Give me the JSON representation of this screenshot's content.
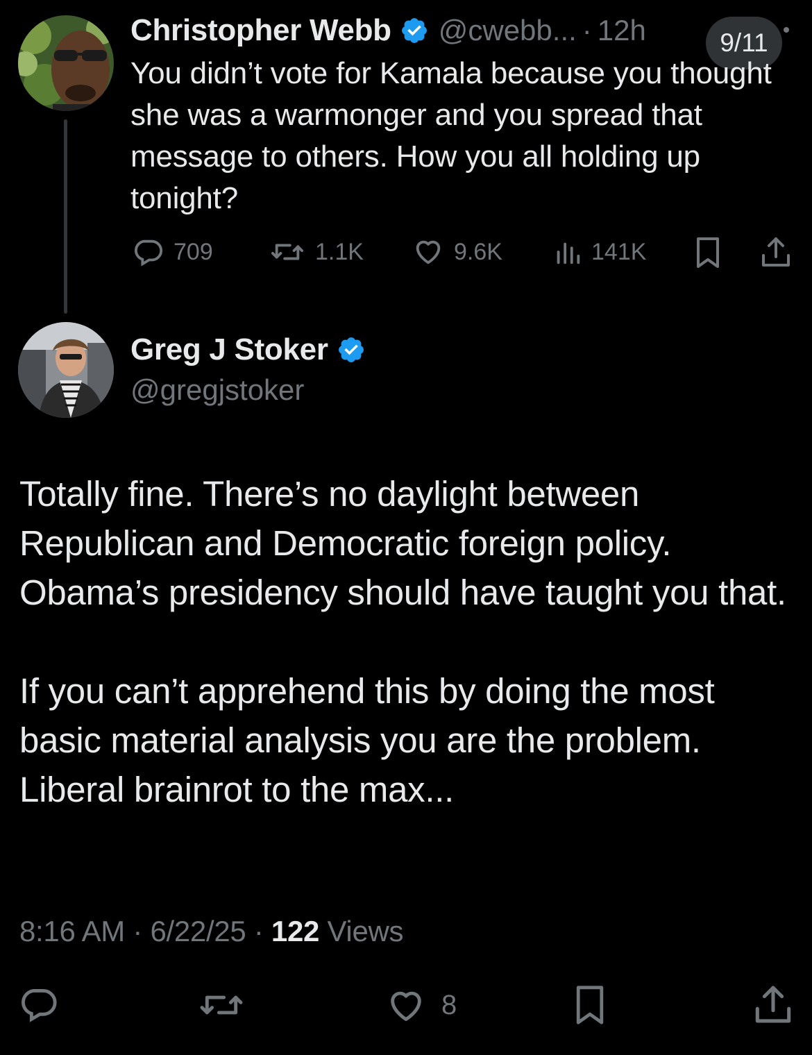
{
  "overlay": {
    "page_indicator": "9/11"
  },
  "parent_tweet": {
    "author_name": "Christopher Webb",
    "handle": "@cwebb...",
    "separator": "·",
    "time_ago": "12h",
    "text": "You didn’t vote for Kamala because you thought she was a warmonger and you spread that message to others. How you all holding up tonight?",
    "stats": {
      "replies": "709",
      "reposts": "1.1K",
      "likes": "9.6K",
      "views": "141K"
    }
  },
  "reply_tweet": {
    "author_name": "Greg J Stoker",
    "handle": "@gregjstoker",
    "paragraphs": [
      "Totally fine. There’s no daylight between Republican and Democratic foreign policy. Obama’s presidency should have taught you that.",
      "If you can’t apprehend this by doing the most basic material analysis you are the problem. Liberal brainrot to the max..."
    ],
    "time": "8:16 AM",
    "date": "6/22/25",
    "separator": "·",
    "views_count": "122",
    "views_label": "Views",
    "stats": {
      "likes": "8"
    }
  },
  "colors": {
    "background": "#000000",
    "text": "#e7e9ea",
    "secondary_text": "#71767b",
    "verified_badge": "#1d9bf0",
    "thread_line": "#333639",
    "pill": "#2f3336"
  },
  "icons": {
    "reply": "reply-icon",
    "repost": "repost-icon",
    "like": "heart-icon",
    "views": "bar-chart-icon",
    "bookmark": "bookmark-icon",
    "share": "share-icon",
    "verified": "verified-badge-icon"
  }
}
